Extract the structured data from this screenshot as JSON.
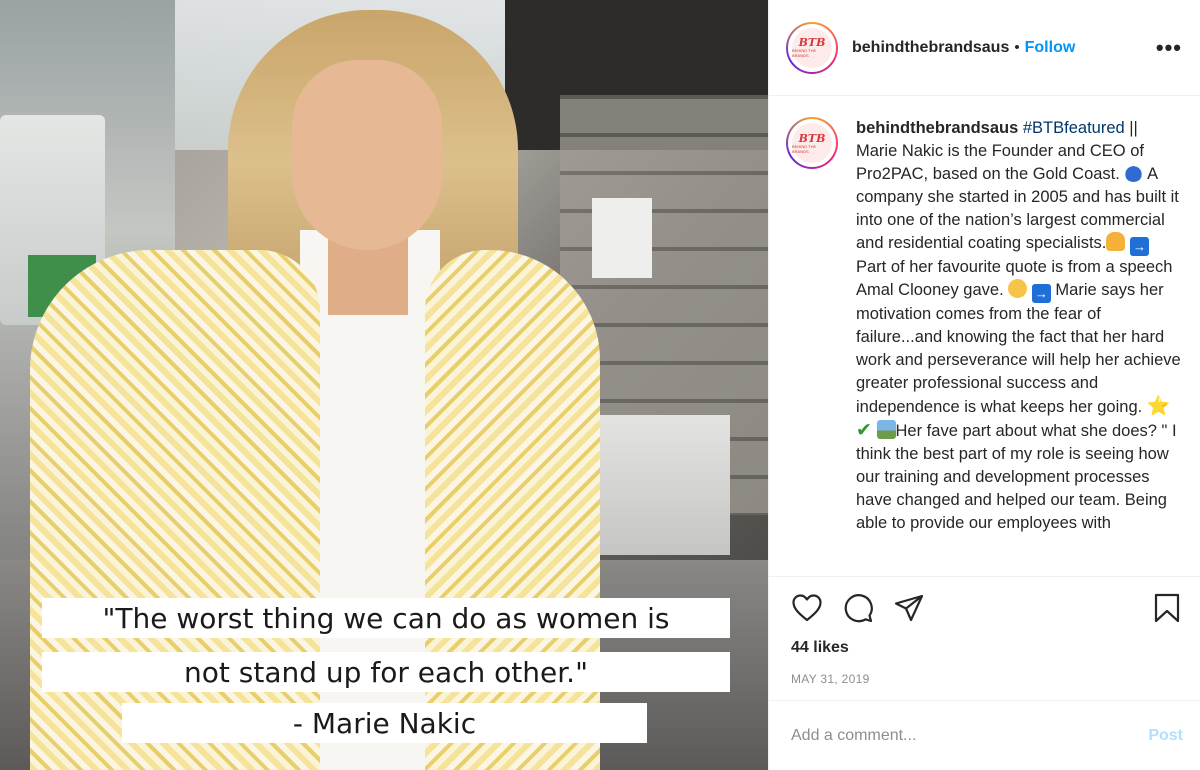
{
  "post": {
    "username": "behindthebrandsaus",
    "follow_label": "Follow",
    "separator": "•",
    "more_icon": "more-options-icon",
    "avatar": {
      "brand": "BTB",
      "tagline": "BEHIND THE BRANDS",
      "ring_colors": [
        "#f9a12e",
        "#ee2a7b",
        "#6228d7"
      ],
      "brand_color": "#d6373a"
    }
  },
  "image": {
    "quote_line_1": "\"The worst thing we can do as women is",
    "quote_line_2": "not stand up for each other.\"",
    "quote_author": "- Marie Nakic"
  },
  "caption": {
    "username": "behindthebrandsaus",
    "hashtag": "#BTBfeatured",
    "seg1": " || Marie Nakic is the Founder and CEO of Pro2PAC, based on the Gold Coast. ",
    "seg2": " A company she started in 2005 and has built it into one of the nation’s largest commercial and residential coating specialists.",
    "seg3": " Part of her favourite quote is from a speech Amal Clooney gave. ",
    "seg4": " Marie says her motivation comes from the fear of failure...and knowing the fact that her hard work and perseverance will help her achieve greater professional success and independence is what keeps her going. ",
    "seg5": "Her fave part about what she does? \" I think the best part of my role is seeing how our training and development processes have changed and helped our team. Being able to provide our employees with",
    "emoji": {
      "car": "car-emoji",
      "arrow": "→",
      "pray": "pray-emoji",
      "ok": "ok-hand-emoji",
      "star": "⭐",
      "check": "✔",
      "scene": "sunrise-emoji"
    }
  },
  "actions": {
    "like_icon": "heart-icon",
    "comment_icon": "comment-icon",
    "share_icon": "share-icon",
    "save_icon": "bookmark-icon",
    "likes": "44 likes",
    "date": "MAY 31, 2019"
  },
  "comment_box": {
    "placeholder": "Add a comment...",
    "post_label": "Post",
    "post_color": "#b2dffc"
  },
  "colors": {
    "accent": "#0095f6",
    "hashtag": "#00376b",
    "muted": "#8e8e8e",
    "text": "#262626"
  }
}
